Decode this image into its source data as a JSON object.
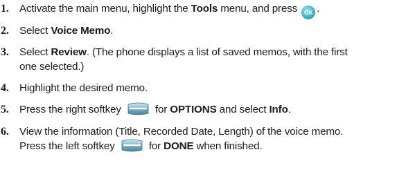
{
  "steps": [
    {
      "num": "1.",
      "pre": "Activate the main menu, highlight the ",
      "bold1": "Tools",
      "mid": " menu, and press ",
      "icon": "ok-button-icon",
      "icon_text": "OK",
      "post": "."
    },
    {
      "num": "2.",
      "pre": "Select ",
      "bold1": "Voice Memo",
      "post": "."
    },
    {
      "num": "3.",
      "pre": "Select ",
      "bold1": "Review",
      "post": ". (The phone displays a list of saved memos, with the first",
      "line2": "one selected.)"
    },
    {
      "num": "4.",
      "text": "Highlight the desired memo."
    },
    {
      "num": "5.",
      "pre": "Press the right softkey ",
      "icon": "right-softkey-icon",
      "mid": " for ",
      "bold1": "OPTIONS",
      "mid2": " and select ",
      "bold2": "Info",
      "post": "."
    },
    {
      "num": "6.",
      "line1": "View the information (Title, Recorded Date, Length) of the voice memo.",
      "pre": "Press the left softkey ",
      "icon": "left-softkey-icon",
      "mid": " for ",
      "bold1": "DONE",
      "post": " when finished."
    }
  ]
}
